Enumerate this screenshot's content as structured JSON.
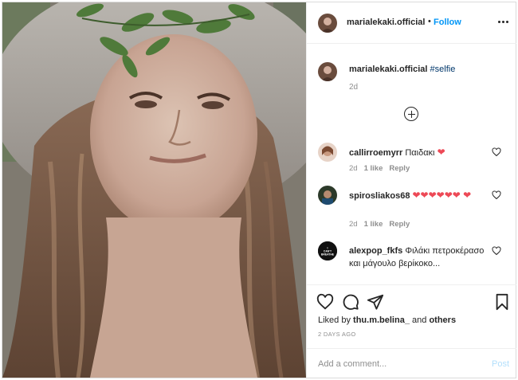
{
  "header": {
    "username": "marialekaki.official",
    "separator": "•",
    "follow_label": "Follow"
  },
  "caption": {
    "username": "marialekaki.official",
    "hashtag": "#selfie",
    "time": "2d"
  },
  "comments": [
    {
      "username": "callirroemyrr",
      "text": "Παιδακι",
      "hearts": "❤",
      "time": "2d",
      "likes": "1 like",
      "reply": "Reply"
    },
    {
      "username": "spirosliakos68",
      "text": "",
      "hearts": "❤❤❤❤❤❤ ❤",
      "time": "2d",
      "likes": "1 like",
      "reply": "Reply"
    },
    {
      "username": "alexpop_fkfs",
      "text": "Φιλάκι πετροκέρασο και μάγουλο βερίκοκο...",
      "hearts": "",
      "avatar_text": "I CAN'T BREATHE"
    }
  ],
  "liked_by": {
    "prefix": "Liked by",
    "user": "thu.m.belina_",
    "conj": "and",
    "others": "others"
  },
  "posted": "2 DAYS AGO",
  "add_comment": {
    "placeholder": "Add a comment...",
    "post_label": "Post"
  },
  "colors": {
    "accent": "#0095f6",
    "heart": "#ed4956",
    "muted": "#8e8e8e",
    "post_disabled": "#b2dffc"
  }
}
